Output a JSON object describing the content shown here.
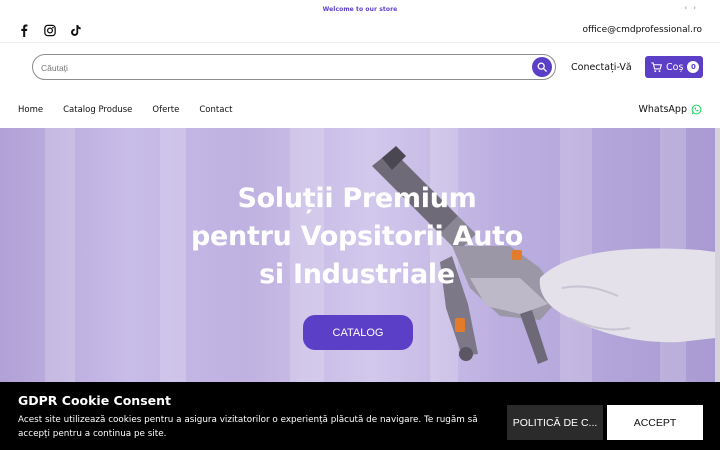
{
  "announcement": {
    "text": "Welcome to our store"
  },
  "topbar": {
    "socials": [
      "facebook-icon",
      "instagram-icon",
      "tiktok-icon"
    ],
    "email": "office@cmdprofessional.ro"
  },
  "header": {
    "search_placeholder": "Căutați",
    "login_label": "Conectați-Vă",
    "cart_label": "Coș",
    "cart_count": "0"
  },
  "nav": {
    "items": [
      {
        "label": "Home"
      },
      {
        "label": "Catalog Produse"
      },
      {
        "label": "Oferte"
      },
      {
        "label": "Contact"
      }
    ],
    "whatsapp_label": "WhatsApp"
  },
  "hero": {
    "line1": "Soluții Premium",
    "line2": "pentru Vopsitorii Auto",
    "line3": "si Industriale",
    "button_label": "CATALOG"
  },
  "cookie": {
    "title": "GDPR Cookie Consent",
    "text": "Acest site utilizează cookies pentru a asigura vizitatorilor o experiență plăcută de navigare. Te rugăm să accepți pentru a continua pe site.",
    "policy_label": "POLITICĂ DE C...",
    "accept_label": "ACCEPT"
  },
  "colors": {
    "accent": "#5b3fc7",
    "cookie_bg": "#000000"
  }
}
